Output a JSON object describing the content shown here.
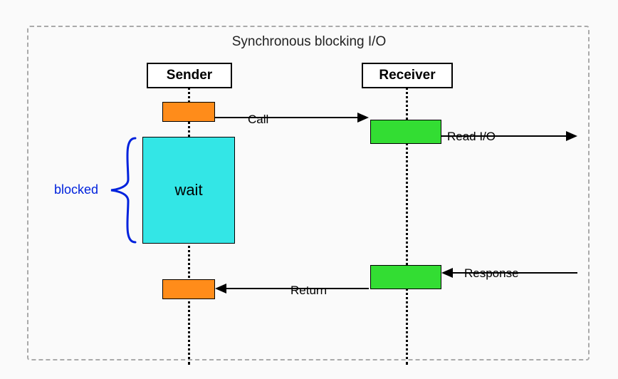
{
  "title": "Synchronous blocking I/O",
  "actors": {
    "sender": "Sender",
    "receiver": "Receiver"
  },
  "labels": {
    "call": "Call",
    "return": "Return",
    "readio": "Read I/O",
    "response": "Response",
    "wait": "wait",
    "blocked": "blocked"
  },
  "colors": {
    "active": "#ff8c1a",
    "processing": "#33dd33",
    "waiting": "#33e6e6",
    "brace": "#0022dd"
  }
}
